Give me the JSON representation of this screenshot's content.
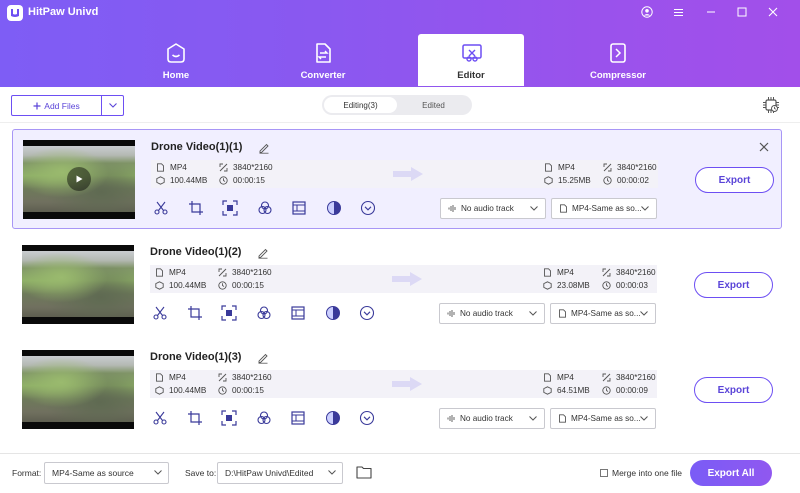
{
  "app": {
    "title": "HitPaw Univd"
  },
  "nav": {
    "tabs": [
      {
        "label": "Home",
        "icon": "home-icon"
      },
      {
        "label": "Converter",
        "icon": "converter-icon"
      },
      {
        "label": "Editor",
        "icon": "editor-icon",
        "active": true
      },
      {
        "label": "Compressor",
        "icon": "compressor-icon"
      }
    ]
  },
  "toolbar": {
    "add_files_label": "Add Files",
    "segments": [
      {
        "label": "Editing(3)",
        "active": true
      },
      {
        "label": "Edited",
        "active": false
      }
    ]
  },
  "videos": [
    {
      "title": "Drone Video(1)(1)",
      "selected": true,
      "source": {
        "format": "MP4",
        "resolution": "3840*2160",
        "size": "100.44MB",
        "duration": "00:00:15"
      },
      "output": {
        "format": "MP4",
        "resolution": "3840*2160",
        "size": "15.25MB",
        "duration": "00:00:02"
      },
      "audio": "No audio track",
      "output_format": "MP4-Same as so...",
      "export_label": "Export"
    },
    {
      "title": "Drone Video(1)(2)",
      "selected": false,
      "source": {
        "format": "MP4",
        "resolution": "3840*2160",
        "size": "100.44MB",
        "duration": "00:00:15"
      },
      "output": {
        "format": "MP4",
        "resolution": "3840*2160",
        "size": "23.08MB",
        "duration": "00:00:03"
      },
      "audio": "No audio track",
      "output_format": "MP4-Same as so...",
      "export_label": "Export"
    },
    {
      "title": "Drone Video(1)(3)",
      "selected": false,
      "source": {
        "format": "MP4",
        "resolution": "3840*2160",
        "size": "100.44MB",
        "duration": "00:00:15"
      },
      "output": {
        "format": "MP4",
        "resolution": "3840*2160",
        "size": "64.51MB",
        "duration": "00:00:09"
      },
      "audio": "No audio track",
      "output_format": "MP4-Same as so...",
      "export_label": "Export"
    }
  ],
  "footer": {
    "format_label": "Format:",
    "format_value": "MP4-Same as source",
    "save_to_label": "Save to:",
    "save_to_value": "D:\\HitPaw Univd\\Edited",
    "merge_label": "Merge into one file",
    "export_all_label": "Export All"
  },
  "colors": {
    "accent": "#6d4ff3",
    "header_start": "#7e5df5",
    "header_end": "#a24fea",
    "selected_bg": "#f1efff"
  }
}
